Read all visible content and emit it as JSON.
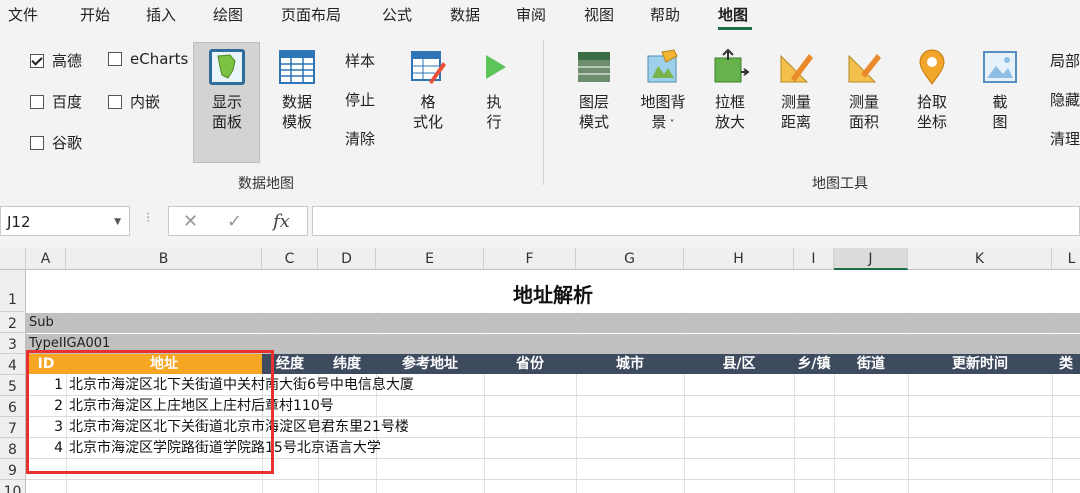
{
  "menu": {
    "tabs": [
      "文件",
      "开始",
      "插入",
      "绘图",
      "页面布局",
      "公式",
      "数据",
      "审阅",
      "视图",
      "帮助",
      "地图"
    ],
    "active": "地图"
  },
  "ribbon": {
    "checkboxes": [
      {
        "label": "高德",
        "checked": true
      },
      {
        "label": "百度",
        "checked": false
      },
      {
        "label": "谷歌",
        "checked": false
      },
      {
        "label": "eCharts",
        "checked": false
      },
      {
        "label": "内嵌",
        "checked": false
      }
    ],
    "show_panel": [
      "显示",
      "面板"
    ],
    "data_template": [
      "数据",
      "模板"
    ],
    "sample": "样本",
    "stop": "停止",
    "clear": "清除",
    "format": [
      "格",
      "式化"
    ],
    "execute": [
      "执",
      "行"
    ],
    "group_data_map": "数据地图",
    "layer_mode": [
      "图层",
      "模式"
    ],
    "map_bg": [
      "地图背",
      "景"
    ],
    "zoom_box": [
      "拉框",
      "放大"
    ],
    "measure_dist": [
      "测量",
      "距离"
    ],
    "measure_area": [
      "测量",
      "面积"
    ],
    "pick_coord": [
      "拾取",
      "坐标"
    ],
    "screenshot": [
      "截",
      "图"
    ],
    "partial": "局部",
    "hide": "隐藏",
    "clean": "清理",
    "group_map_tools": "地图工具"
  },
  "formula": {
    "cell_ref": "J12",
    "fx": "fx",
    "value": ""
  },
  "sheet": {
    "columns": [
      "A",
      "B",
      "C",
      "D",
      "E",
      "F",
      "G",
      "H",
      "I",
      "J",
      "K",
      "L"
    ],
    "rows": [
      "1",
      "2",
      "3",
      "4",
      "5",
      "6",
      "7",
      "8",
      "9",
      "10"
    ],
    "title": "地址解析",
    "sub": "Sub",
    "type": "TypeIIGA001",
    "headers": [
      "ID",
      "地址",
      "经度",
      "纬度",
      "参考地址",
      "省份",
      "城市",
      "县/区",
      "乡/镇",
      "街道",
      "更新时间",
      "类"
    ],
    "data": [
      {
        "id": "1",
        "addr": "北京市海淀区北下关街道中关村南大街6号中电信息大厦"
      },
      {
        "id": "2",
        "addr": "北京市海淀区上庄地区上庄村后章村110号"
      },
      {
        "id": "3",
        "addr": "北京市海淀区北下关街道北京市海淀区皂君东里21号楼"
      },
      {
        "id": "4",
        "addr": "北京市海淀区学院路街道学院路15号北京语言大学"
      }
    ]
  },
  "colors": {
    "header_bg": "#3e4a5e",
    "highlight_header": "#f5a623",
    "callout_border": "#e8312e",
    "accent": "#1e6e43"
  }
}
